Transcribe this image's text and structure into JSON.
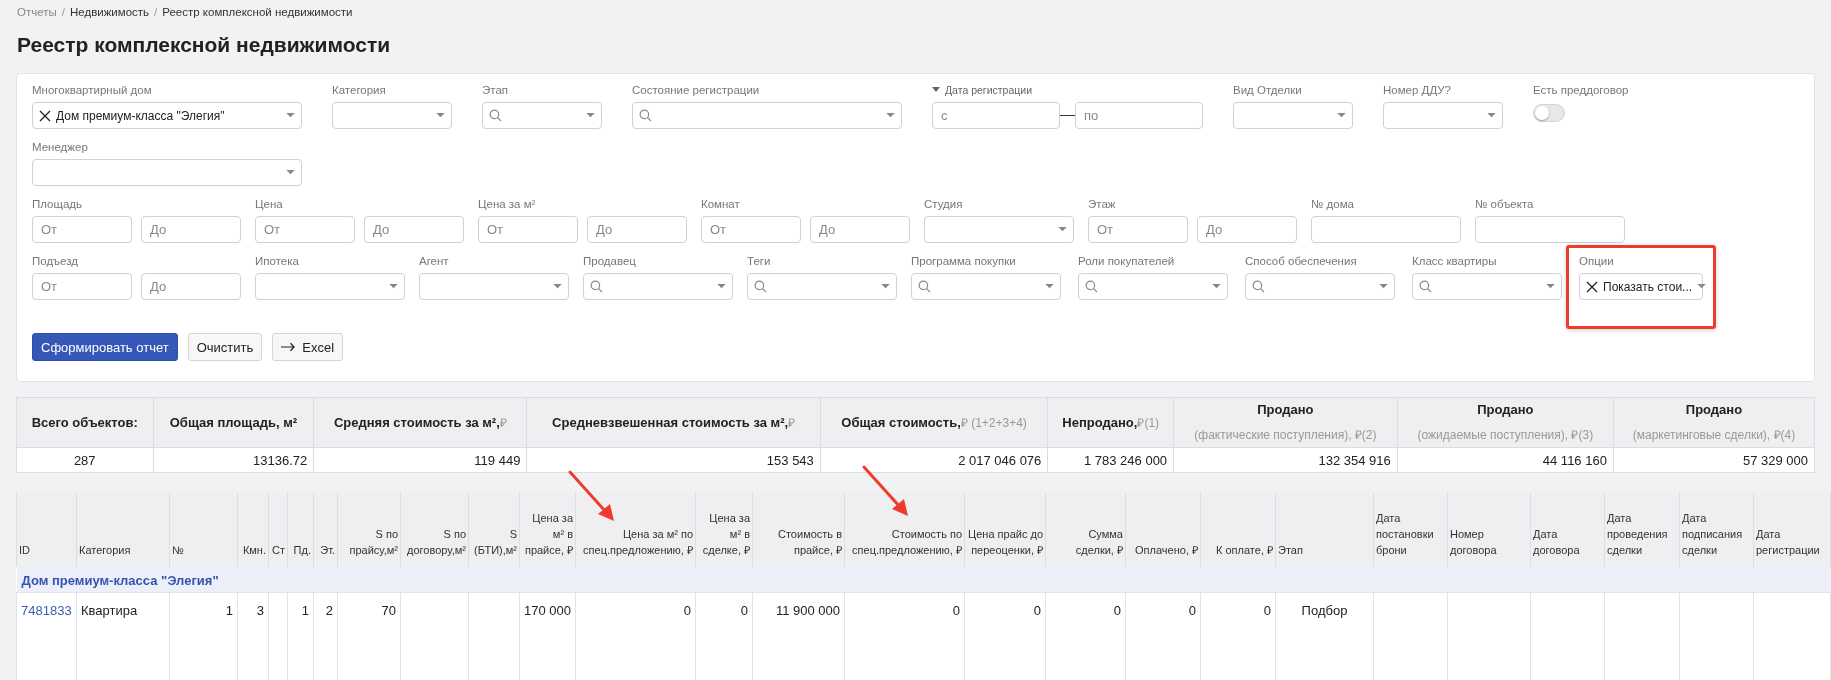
{
  "breadcrumb_separator": "/",
  "breadcrumb": [
    {
      "label": "Отчеты",
      "dimmed": true
    },
    {
      "label": "Недвижимость",
      "dimmed": false
    },
    {
      "label": "Реестр комплексной недвижимости",
      "dimmed": false
    }
  ],
  "title": "Реестр комплексной недвижимости",
  "filters": {
    "fields": [
      {
        "label": "Многоквартирный дом",
        "kind": "tag",
        "value": "Дом премиум-класса \"Элегия\"",
        "highlighted": false
      },
      {
        "label": "Категория",
        "kind": "select",
        "highlighted": false
      },
      {
        "label": "Этап",
        "kind": "search",
        "highlighted": false
      },
      {
        "label": "Состояние регистрации",
        "kind": "search",
        "highlighted": false
      },
      {
        "label": "Дата регистрации",
        "kind": "date_range",
        "from_placeholder": "с",
        "to_placeholder": "по",
        "highlighted": false
      },
      {
        "label": "Вид Отделки",
        "kind": "select",
        "highlighted": false
      },
      {
        "label": "Номер ДДУ?",
        "kind": "select",
        "highlighted": false
      },
      {
        "label": "Есть преддоговор",
        "kind": "toggle",
        "on": false,
        "highlighted": false
      },
      {
        "label": "Менеджер",
        "kind": "select",
        "highlighted": false
      },
      {
        "label": "Площадь",
        "kind": "range",
        "from_placeholder": "От",
        "to_placeholder": "До",
        "highlighted": false
      },
      {
        "label": "Цена",
        "kind": "range",
        "from_placeholder": "От",
        "to_placeholder": "До",
        "highlighted": false
      },
      {
        "label": "Цена за м²",
        "kind": "range",
        "from_placeholder": "От",
        "to_placeholder": "До",
        "highlighted": false
      },
      {
        "label": "Комнат",
        "kind": "range",
        "from_placeholder": "От",
        "to_placeholder": "До",
        "highlighted": false
      },
      {
        "label": "Студия",
        "kind": "select",
        "highlighted": false
      },
      {
        "label": "Этаж",
        "kind": "range",
        "from_placeholder": "От",
        "to_placeholder": "До",
        "highlighted": false
      },
      {
        "label": "№ дома",
        "kind": "text",
        "highlighted": false
      },
      {
        "label": "№ объекта",
        "kind": "text",
        "highlighted": false
      },
      {
        "label": "Подъезд",
        "kind": "range",
        "from_placeholder": "От",
        "to_placeholder": "До",
        "highlighted": false
      },
      {
        "label": "Ипотека",
        "kind": "select",
        "highlighted": false
      },
      {
        "label": "Агент",
        "kind": "select",
        "highlighted": false
      },
      {
        "label": "Продавец",
        "kind": "search",
        "highlighted": false
      },
      {
        "label": "Теги",
        "kind": "search",
        "highlighted": false
      },
      {
        "label": "Программа покупки",
        "kind": "search",
        "highlighted": false
      },
      {
        "label": "Роли покупателей",
        "kind": "search",
        "highlighted": false
      },
      {
        "label": "Способ обеспечения",
        "kind": "search",
        "highlighted": false
      },
      {
        "label": "Класс квартиры",
        "kind": "search",
        "highlighted": false
      },
      {
        "label": "Опции",
        "kind": "tag",
        "value": "Показать стои...",
        "highlighted": true
      }
    ],
    "buttons": [
      {
        "label": "Сформировать отчет",
        "kind": "primary"
      },
      {
        "label": "Очистить",
        "kind": "plain"
      },
      {
        "label": "Excel",
        "kind": "export"
      }
    ]
  },
  "summary": {
    "columns": [
      {
        "title": "Всего объектов:",
        "kind": "plain"
      },
      {
        "title": "Общая площадь, м²",
        "kind": "plain"
      },
      {
        "title": "Средняя стоимость за м²,",
        "note": "₽",
        "kind": "inline"
      },
      {
        "title": "Средневзвешенная стоимость за м²,",
        "note": "₽",
        "kind": "inline"
      },
      {
        "title": "Общая стоимость,",
        "note": "₽ (1+2+3+4)",
        "kind": "inline"
      },
      {
        "title": "Непродано,",
        "note": "₽(1)",
        "kind": "inline"
      },
      {
        "title": "Продано",
        "note": "(фактические поступления), ₽(2)",
        "kind": "stacked"
      },
      {
        "title": "Продано",
        "note": "(ожидаемые поступления), ₽(3)",
        "kind": "stacked"
      },
      {
        "title": "Продано",
        "note": "(маркетинговые сделки), ₽(4)",
        "kind": "stacked"
      }
    ],
    "values": [
      "287",
      "13136.72",
      "119 449",
      "153 543",
      "2 017 046 076",
      "1 783 246 000",
      "132 354 916",
      "44 116 160",
      "57 329 000"
    ]
  },
  "table": {
    "columns": [
      {
        "label": "ID",
        "kind": "link"
      },
      {
        "label": "Категория",
        "kind": "text"
      },
      {
        "label": "№",
        "kind": "index"
      },
      {
        "label": "Кмн.",
        "kind": "number"
      },
      {
        "label": "Ст",
        "kind": "number"
      },
      {
        "label": "Пд.",
        "kind": "number"
      },
      {
        "label": "Эт.",
        "kind": "number"
      },
      {
        "label": "S по прайсу,м²",
        "kind": "number"
      },
      {
        "label": "S по договору,м²",
        "kind": "number"
      },
      {
        "label": "S (БТИ),м²",
        "kind": "number"
      },
      {
        "label": "Цена за м² в прайсе, ₽",
        "kind": "number"
      },
      {
        "label": "Цена за м² по спец.предложению, ₽",
        "kind": "number"
      },
      {
        "label": "Цена за м² в сделке, ₽",
        "kind": "number"
      },
      {
        "label": "Стоимость в прайсе, ₽",
        "kind": "number"
      },
      {
        "label": "Стоимость по спец.предложению, ₽",
        "kind": "number"
      },
      {
        "label": "Цена прайс до переоценки, ₽",
        "kind": "number"
      },
      {
        "label": "Сумма сделки, ₽",
        "kind": "number"
      },
      {
        "label": "Оплачено, ₽",
        "kind": "number"
      },
      {
        "label": "К оплате, ₽",
        "kind": "number"
      },
      {
        "label": "Этап",
        "kind": "status"
      },
      {
        "label": "Дата постановки брони",
        "kind": "text"
      },
      {
        "label": "Номер договора",
        "kind": "text"
      },
      {
        "label": "Дата договора",
        "kind": "text"
      },
      {
        "label": "Дата проведения сделки",
        "kind": "text"
      },
      {
        "label": "Дата подписания сделки",
        "kind": "text"
      },
      {
        "label": "Дата регистрации",
        "kind": "text"
      }
    ],
    "groups": [
      {
        "title": "Дом премиум-класса \"Элегия\"",
        "rows": [
          {
            "cells": [
              "7481833",
              "Квартира",
              "1",
              "3",
              null,
              "1",
              "2",
              "70",
              null,
              null,
              "170 000",
              "0",
              "0",
              "11 900 000",
              "0",
              "0",
              "0",
              "0",
              "0",
              "Подбор",
              null,
              null,
              null,
              null,
              null,
              null
            ]
          }
        ]
      }
    ]
  }
}
